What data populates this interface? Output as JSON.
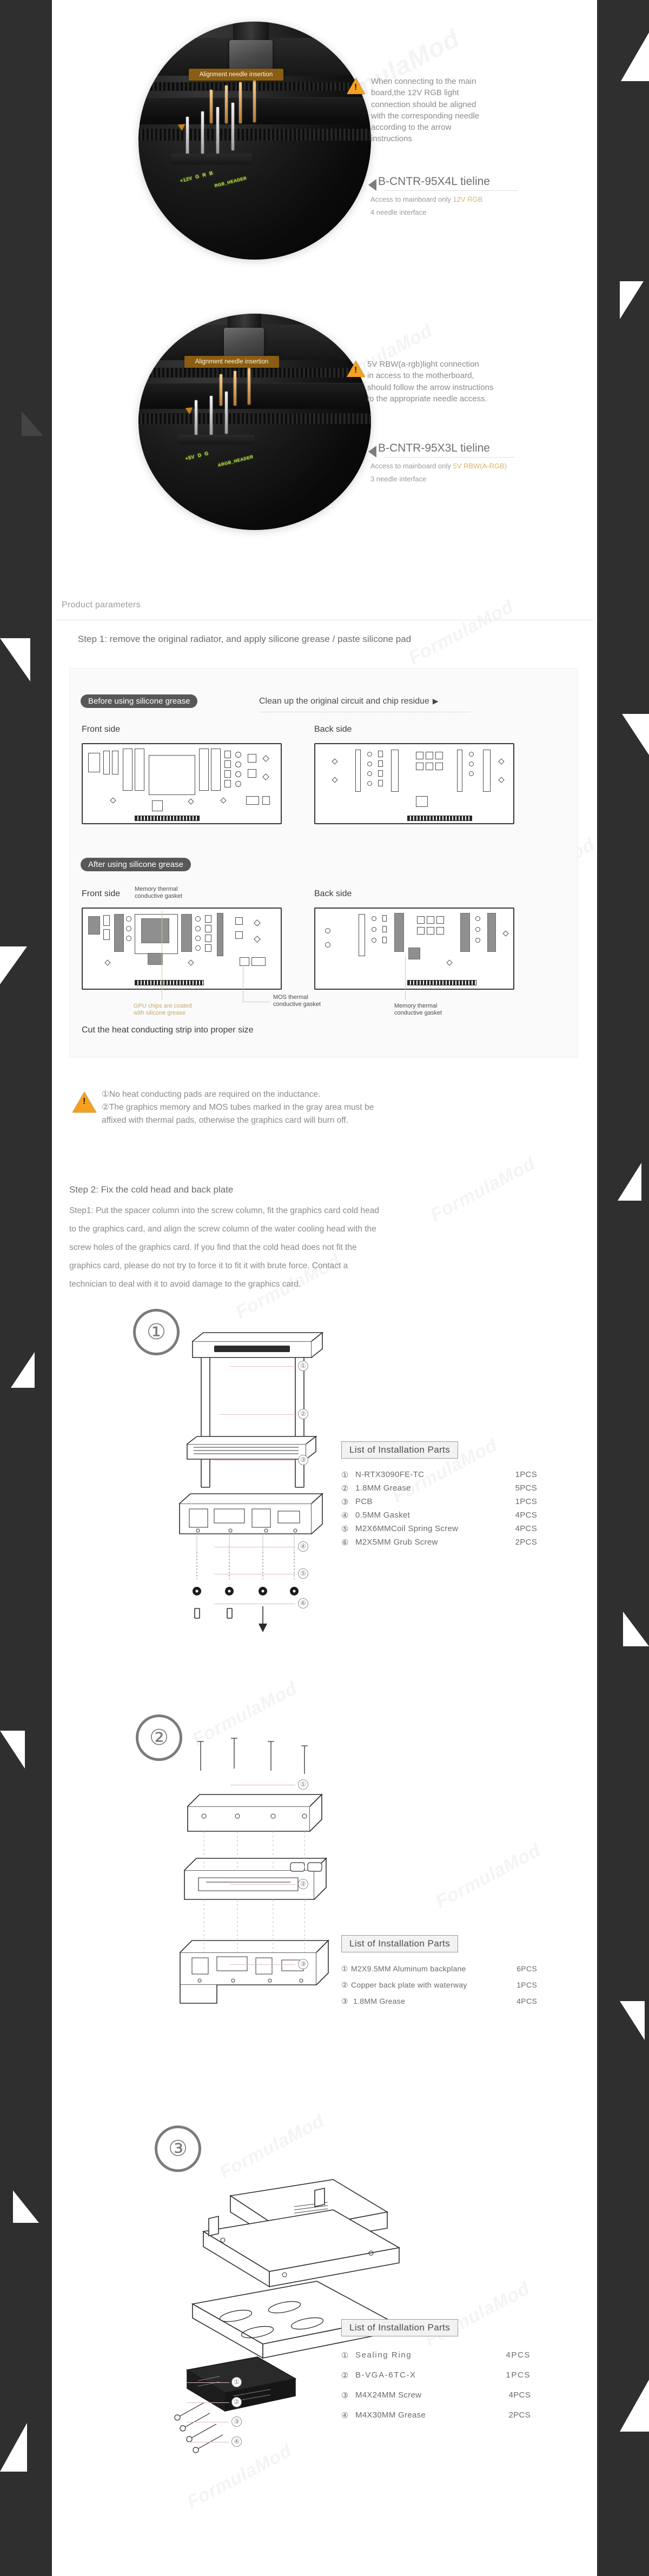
{
  "photos": [
    {
      "callout": "Alignment needle\ninsertion",
      "silkscreens": [
        "+12V",
        "RGB_HEADER",
        "G",
        "R",
        "B"
      ]
    },
    {
      "callout": "Alignment needle\ninsertion",
      "silkscreens": [
        "+5V",
        "ARGB_HEADER",
        "D",
        "G"
      ]
    }
  ],
  "notes": [
    {
      "warning": "When connecting to the main\nboard,the 12V RGB light\nconnection should be aligned\nwith the corresponding needle\naccording to the arrow\ninstructions",
      "tieline": "B-CNTR-95X4L tieline",
      "access_prefix": "Access to mainboard only ",
      "access_highlight": "12V RGB",
      "interface": "4 needle interface"
    },
    {
      "warning": "5V RBW(a-rgb)light connection\nin access to the motherboard,\nshould follow the arrow instructions\nto the appropriate needle access.",
      "tieline": "B-CNTR-95X3L tieline",
      "access_prefix": "Access to mainboard only ",
      "access_highlight": "5V RBW(A-RGB)",
      "interface": "3 needle interface"
    }
  ],
  "product_parameters_title": "Product parameters",
  "step1": {
    "heading": "Step 1: remove the original radiator, and apply silicone grease / paste silicone pad",
    "before_pill": "Before using silicone grease",
    "cleanup_note": "Clean up the original circuit and chip residue",
    "after_pill": "After using silicone grease",
    "front_side": "Front side",
    "back_side": "Back side",
    "memory_gasket_top": "Memory thermal\nconductive gasket",
    "gpu_grease_label": "GPU chips are coated\nwith silicone grease",
    "mos_gasket_label": "MOS thermal\nconductive gasket",
    "memory_gasket_label": "Memory thermal\nconductive gasket",
    "cut_note": "Cut the heat conducting strip into proper size"
  },
  "cautions": [
    "①No heat conducting pads are required on the inductance.",
    "②The graphics memory and MOS tubes marked in the gray area must be",
    "     affixed with thermal pads, otherwise the graphics card will burn off."
  ],
  "step2": {
    "heading": "Step 2: Fix the cold head and back plate",
    "body": [
      "Step1: Put the spacer column into the screw column, fit the graphics card cold head",
      "to the graphics card, and align the screw column of the water cooling head with the",
      "screw holes of the graphics card. If you find that the cold head does not fit the",
      "graphics card, please do not try to force it to fit it with brute force. Contact a",
      "technician to deal with it to avoid damage to the graphics card."
    ]
  },
  "assemblies": [
    {
      "circle_number": "①",
      "parts_title": "List of Installation Parts",
      "rows": [
        {
          "num": "①",
          "name": "N-RTX3090FE-TC",
          "qty": "1PCS"
        },
        {
          "num": "②",
          "name": "1.8MM  Grease",
          "qty": "5PCS"
        },
        {
          "num": "③",
          "name": "PCB",
          "qty": "1PCS"
        },
        {
          "num": "④",
          "name": "0.5MM Gasket",
          "qty": "4PCS"
        },
        {
          "num": "⑤",
          "name": "M2X6MMCoil  Spring  Screw",
          "qty": "4PCS"
        },
        {
          "num": "⑥",
          "name": "M2X5MM Grub Screw",
          "qty": "2PCS"
        }
      ],
      "callouts": [
        "①",
        "②",
        "③",
        "④",
        "⑤",
        "⑥"
      ]
    },
    {
      "circle_number": "②",
      "parts_title": "List of Installation Parts",
      "rows": [
        {
          "num": "①",
          "name": "M2X9.5MM Aluminum backplane",
          "qty": "6PCS"
        },
        {
          "num": "②",
          "name": "Copper back plate with waterway",
          "qty": "1PCS"
        },
        {
          "num": "③",
          "name": "1.8MM Grease",
          "qty": "4PCS"
        }
      ],
      "callouts": [
        "①",
        "②",
        "③"
      ]
    },
    {
      "circle_number": "③",
      "parts_title": "List of Installation Parts",
      "rows": [
        {
          "num": "①",
          "name": "Sealing  Ring",
          "qty": "4PCS"
        },
        {
          "num": "②",
          "name": "B-VGA-6TC-X",
          "qty": "1PCS"
        },
        {
          "num": "③",
          "name": "M4X24MM Screw",
          "qty": "4PCS"
        },
        {
          "num": "④",
          "name": "M4X30MM Grease",
          "qty": "2PCS"
        }
      ],
      "callouts": [
        "①",
        "②",
        "③",
        "④"
      ]
    }
  ],
  "watermark": "FormulaMod",
  "colors": {
    "accent_orange": "#f5a01e",
    "callout_brown": "#8a5d12",
    "silk_green": "#b7e04a",
    "gold_text": "#d8b46a",
    "rail_dark": "#2f2f2f"
  }
}
